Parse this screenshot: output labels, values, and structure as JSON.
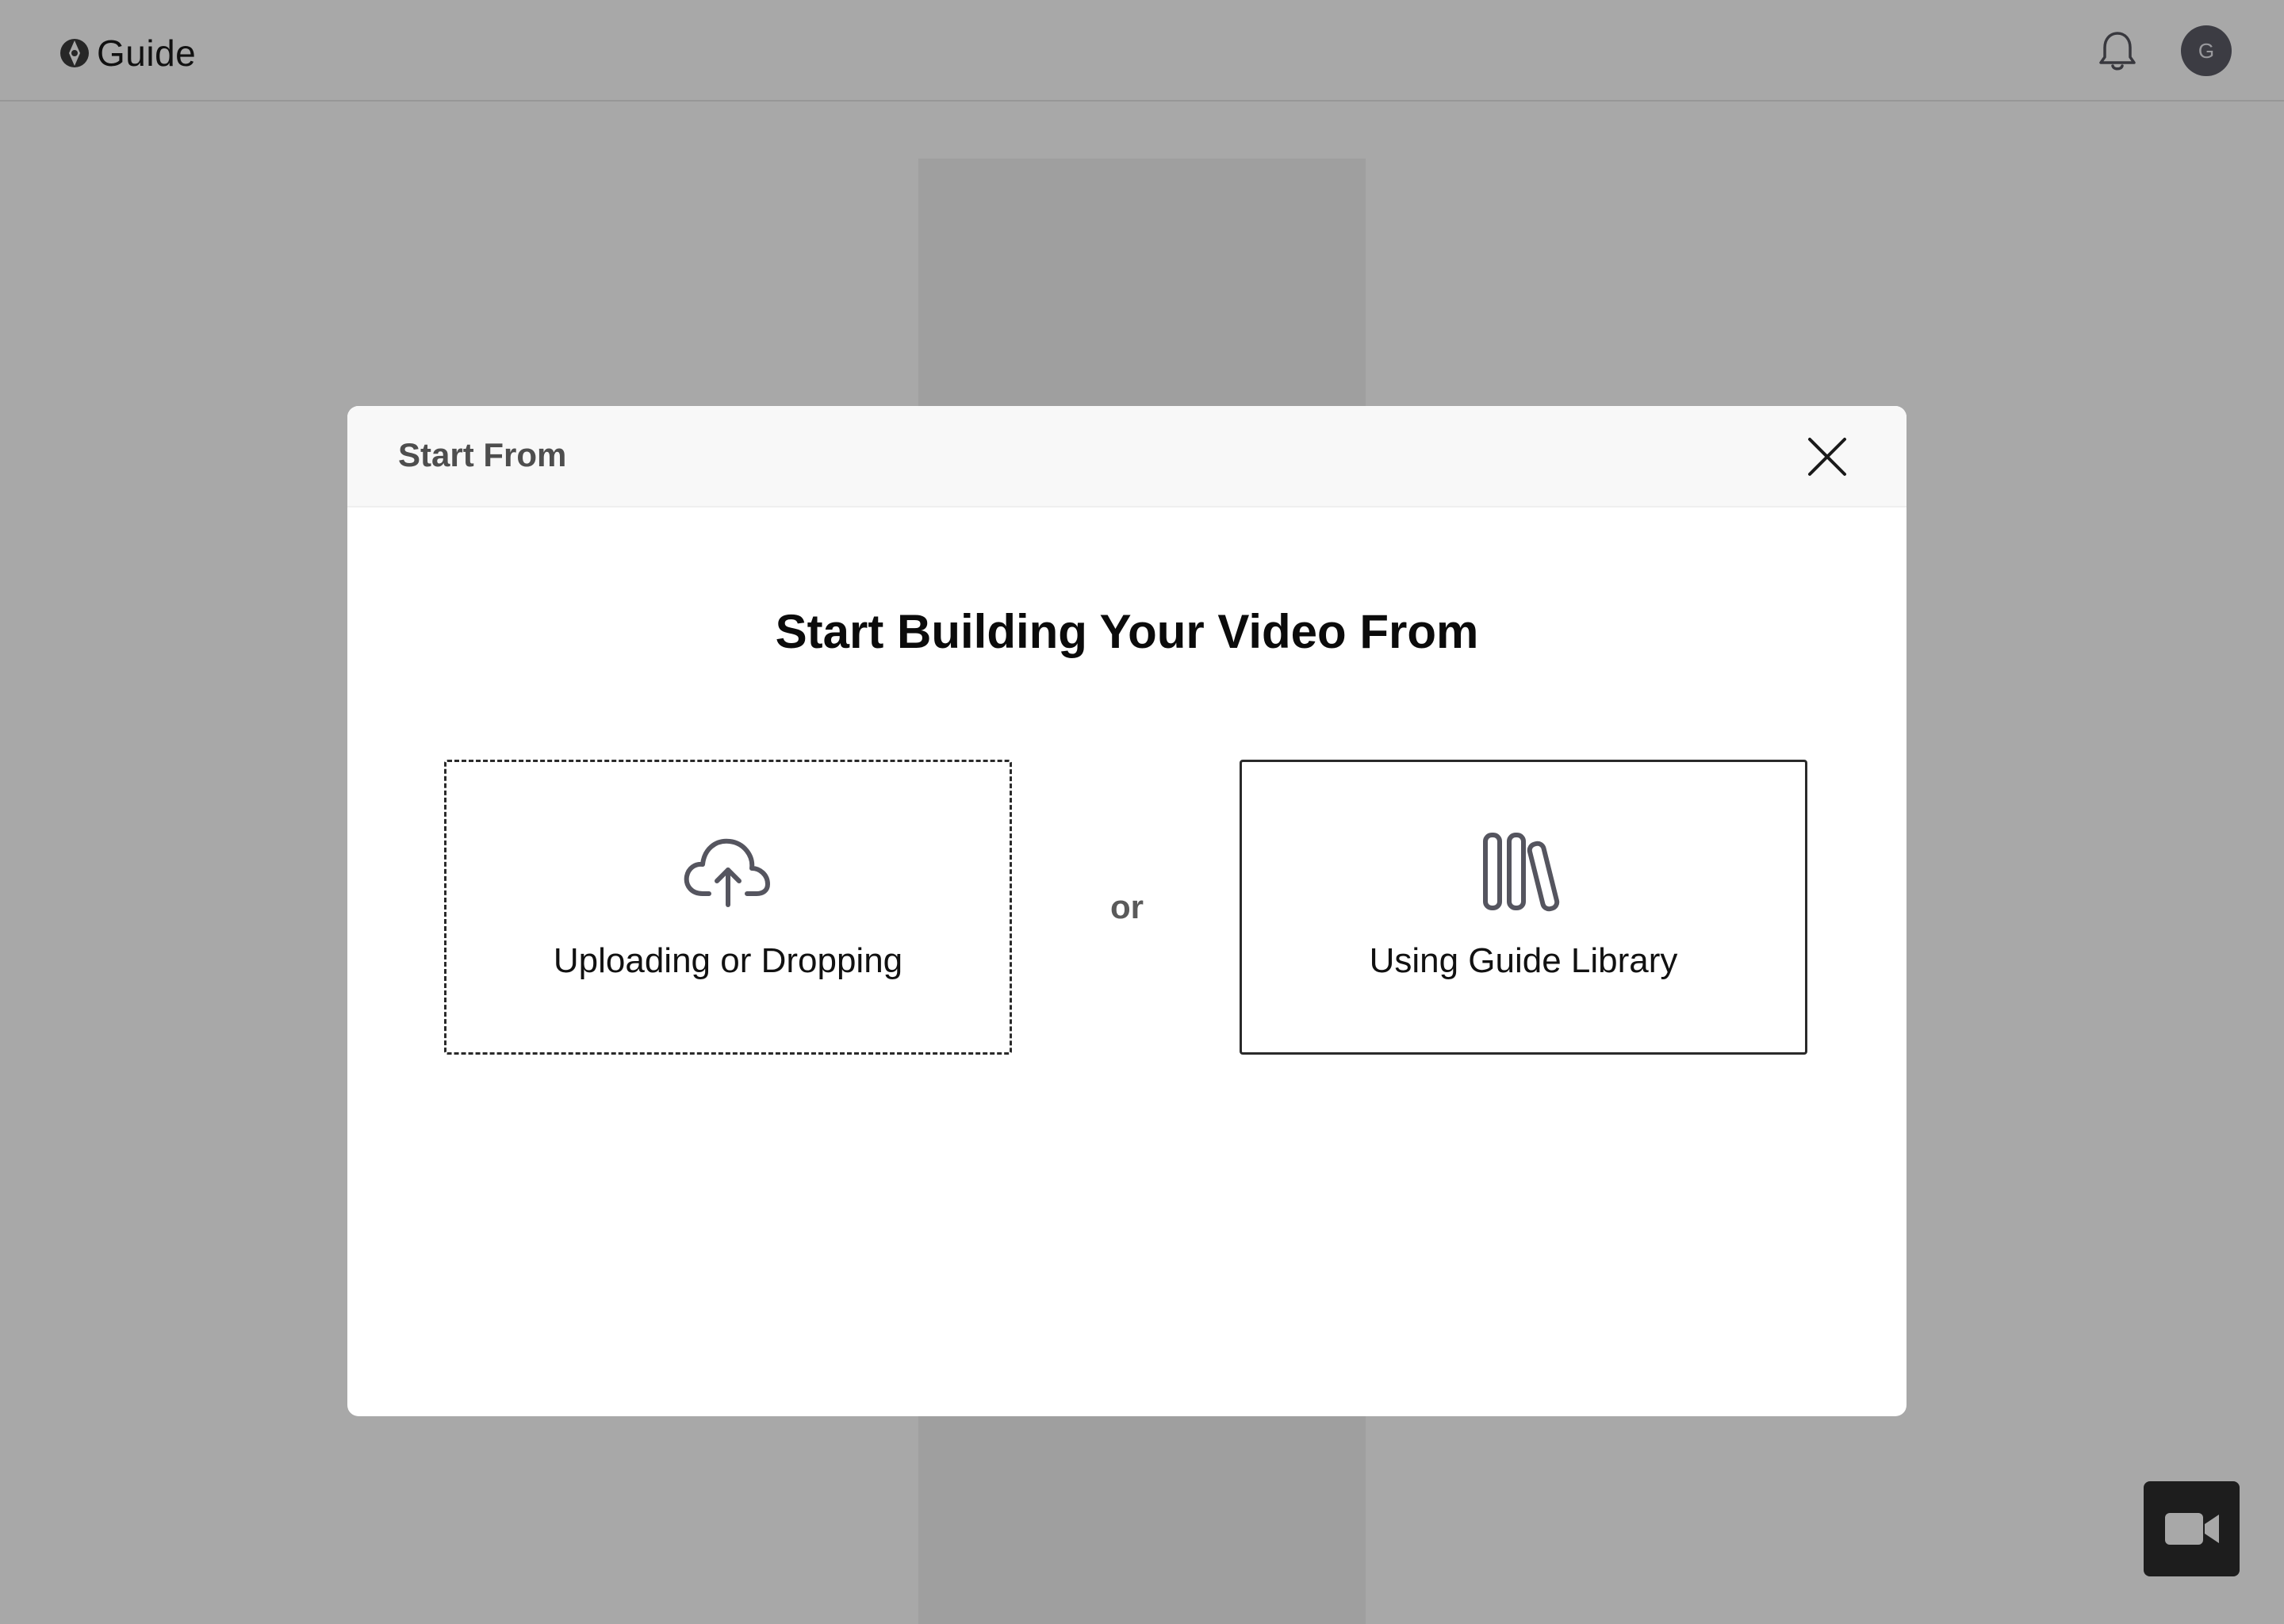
{
  "app": {
    "logo_text": "Guide",
    "avatar_initial": "G"
  },
  "modal": {
    "title": "Start From",
    "heading": "Start Building Your Video From",
    "separator": "or",
    "options": [
      {
        "label": "Uploading or Dropping",
        "icon": "cloud-upload-icon"
      },
      {
        "label": "Using Guide Library",
        "icon": "library-icon"
      }
    ]
  },
  "icons": {
    "bell": "bell-icon",
    "close": "close-icon",
    "record": "video-camera-icon"
  },
  "colors": {
    "overlay": "rgba(0,0,0,0.34)",
    "avatar_bg": "#5b5b66",
    "fab_bg": "#2c2c2c",
    "icon_stroke": "#55555f"
  }
}
